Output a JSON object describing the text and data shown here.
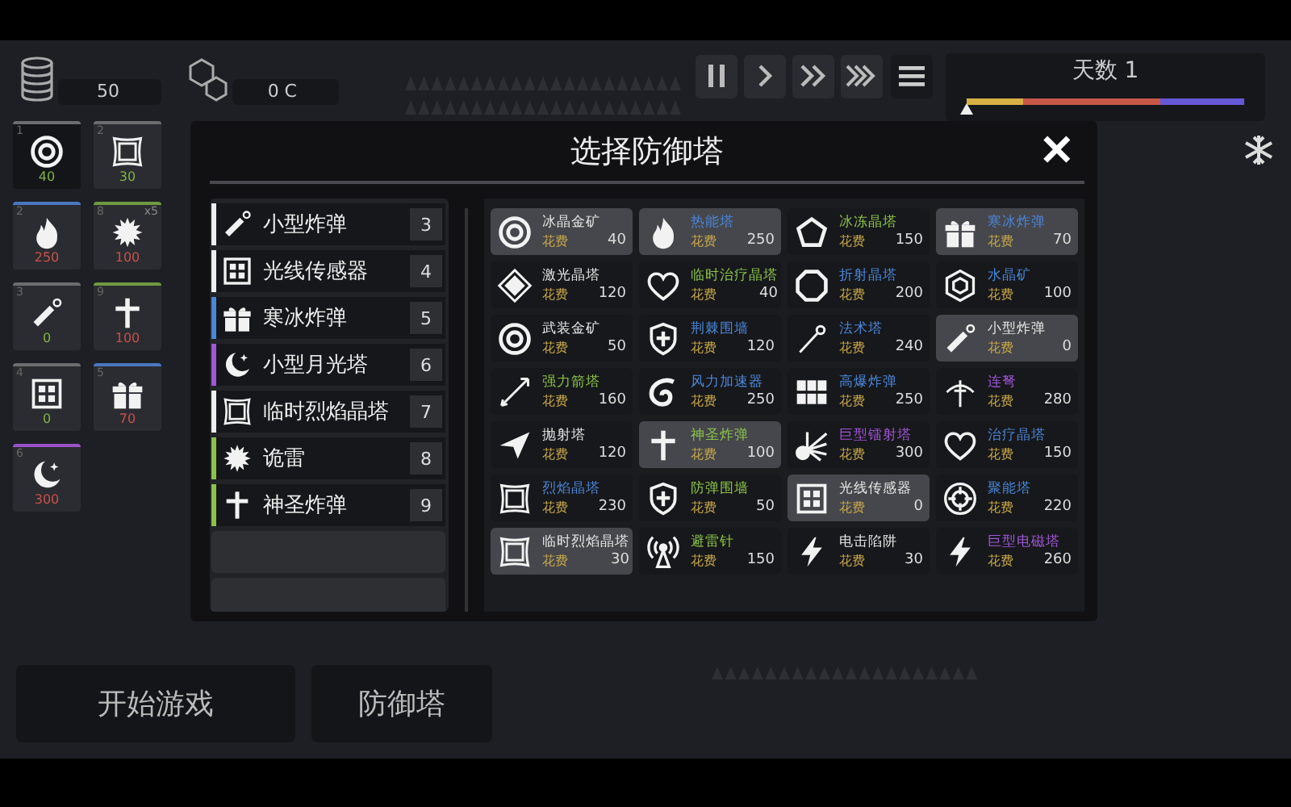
{
  "resources": {
    "coins": "50",
    "crystals": "0 C"
  },
  "day": {
    "label": "天数 1",
    "level": 0,
    "segments": [
      {
        "color": "#d6b044"
      },
      {
        "color": "#c8574a"
      },
      {
        "color": "#6658d6"
      }
    ]
  },
  "loadout": [
    {
      "slot": "1",
      "kind": "ring",
      "cost": "40",
      "affordable": true,
      "color": "#6d6d70",
      "selected": true
    },
    {
      "slot": "2",
      "kind": "frame",
      "cost": "30",
      "affordable": true,
      "color": "#6d6d70",
      "selected": false
    },
    {
      "slot": "2",
      "kind": "flame",
      "cost": "250",
      "affordable": false,
      "color": "#4a78c0",
      "selected": false
    },
    {
      "slot": "8",
      "kind": "burst",
      "cost": "100",
      "affordable": false,
      "color": "#6f9a3e",
      "selected": false,
      "badge": "x5"
    },
    {
      "slot": "3",
      "kind": "stick",
      "cost": "0",
      "affordable": true,
      "color": "#6d6d70",
      "selected": false
    },
    {
      "slot": "9",
      "kind": "cross",
      "cost": "100",
      "affordable": false,
      "color": "#6f9a3e",
      "selected": false
    },
    {
      "slot": "4",
      "kind": "grid",
      "cost": "0",
      "affordable": true,
      "color": "#6d6d70",
      "selected": false
    },
    {
      "slot": "5",
      "kind": "gift",
      "cost": "70",
      "affordable": false,
      "color": "#4a78c0",
      "selected": false
    },
    {
      "slot": "6",
      "kind": "moon",
      "cost": "300",
      "affordable": false,
      "color": "#9a52c8",
      "selected": false
    }
  ],
  "dialog": {
    "title": "选择防御塔",
    "close": "✕",
    "picked": [
      {
        "name": "小型炸弹",
        "key": "3",
        "kind": "stick",
        "color": "#eeeeee"
      },
      {
        "name": "光线传感器",
        "key": "4",
        "kind": "grid",
        "color": "#eeeeee"
      },
      {
        "name": "寒冰炸弹",
        "key": "5",
        "kind": "gift",
        "color": "#4a86d8"
      },
      {
        "name": "小型月光塔",
        "key": "6",
        "kind": "moon",
        "color": "#a057d8"
      },
      {
        "name": "临时烈焰晶塔",
        "key": "7",
        "kind": "frame",
        "color": "#eeeeee"
      },
      {
        "name": "诡雷",
        "key": "8",
        "kind": "burst",
        "color": "#8bc34a"
      },
      {
        "name": "神圣炸弹",
        "key": "9",
        "kind": "cross",
        "color": "#8bc34a"
      }
    ],
    "empty_slots": [
      {
        "kind": "empty"
      },
      {
        "kind": "empty"
      }
    ],
    "towers": [
      {
        "name": "冰晶金矿",
        "cost_label": "花费",
        "cost": "40",
        "kind": "ring",
        "color": "#e6e6e6",
        "selected": true
      },
      {
        "name": "热能塔",
        "cost_label": "花费",
        "cost": "250",
        "kind": "flame",
        "color": "#4a86d8",
        "selected": true
      },
      {
        "name": "冰冻晶塔",
        "cost_label": "花费",
        "cost": "150",
        "kind": "pentagon",
        "color": "#8bc34a",
        "selected": false
      },
      {
        "name": "寒冰炸弹",
        "cost_label": "花费",
        "cost": "70",
        "kind": "gift",
        "color": "#4a86d8",
        "selected": true
      },
      {
        "name": "激光晶塔",
        "cost_label": "花费",
        "cost": "120",
        "kind": "diamond",
        "color": "#e6e6e6",
        "selected": false
      },
      {
        "name": "临时治疗晶塔",
        "cost_label": "花费",
        "cost": "40",
        "kind": "heart",
        "color": "#8bc34a",
        "selected": false
      },
      {
        "name": "折射晶塔",
        "cost_label": "花费",
        "cost": "200",
        "kind": "octagon",
        "color": "#4a86d8",
        "selected": false
      },
      {
        "name": "水晶矿",
        "cost_label": "花费",
        "cost": "100",
        "kind": "gem",
        "color": "#4a86d8",
        "selected": false
      },
      {
        "name": "武装金矿",
        "cost_label": "花费",
        "cost": "50",
        "kind": "ring",
        "color": "#e6e6e6",
        "selected": false
      },
      {
        "name": "荆棘围墙",
        "cost_label": "花费",
        "cost": "120",
        "kind": "shield",
        "color": "#4a86d8",
        "selected": false
      },
      {
        "name": "法术塔",
        "cost_label": "花费",
        "cost": "240",
        "kind": "wand",
        "color": "#4a86d8",
        "selected": false
      },
      {
        "name": "小型炸弹",
        "cost_label": "花费",
        "cost": "0",
        "kind": "stick",
        "color": "#e6e6e6",
        "selected": true
      },
      {
        "name": "强力箭塔",
        "cost_label": "花费",
        "cost": "160",
        "kind": "arrow",
        "color": "#8bc34a",
        "selected": false
      },
      {
        "name": "风力加速器",
        "cost_label": "花费",
        "cost": "250",
        "kind": "swirl",
        "color": "#4a86d8",
        "selected": false
      },
      {
        "name": "高爆炸弹",
        "cost_label": "花费",
        "cost": "250",
        "kind": "cube",
        "color": "#4a86d8",
        "selected": false
      },
      {
        "name": "连弩",
        "cost_label": "花费",
        "cost": "280",
        "kind": "crossbow",
        "color": "#a057d8",
        "selected": false
      },
      {
        "name": "抛射塔",
        "cost_label": "花费",
        "cost": "120",
        "kind": "plane",
        "color": "#e6e6e6",
        "selected": false
      },
      {
        "name": "神圣炸弹",
        "cost_label": "花费",
        "cost": "100",
        "kind": "cross",
        "color": "#8bc34a",
        "selected": true
      },
      {
        "name": "巨型镭射塔",
        "cost_label": "花费",
        "cost": "300",
        "kind": "rays",
        "color": "#a057d8",
        "selected": false
      },
      {
        "name": "治疗晶塔",
        "cost_label": "花费",
        "cost": "150",
        "kind": "heart",
        "color": "#4a86d8",
        "selected": false
      },
      {
        "name": "烈焰晶塔",
        "cost_label": "花费",
        "cost": "230",
        "kind": "frame",
        "color": "#4a86d8",
        "selected": false
      },
      {
        "name": "防弹围墙",
        "cost_label": "花费",
        "cost": "50",
        "kind": "shield",
        "color": "#8bc34a",
        "selected": false
      },
      {
        "name": "光线传感器",
        "cost_label": "花费",
        "cost": "0",
        "kind": "grid",
        "color": "#e6e6e6",
        "selected": true
      },
      {
        "name": "聚能塔",
        "cost_label": "花费",
        "cost": "220",
        "kind": "target",
        "color": "#4a86d8",
        "selected": false
      },
      {
        "name": "临时烈焰晶塔",
        "cost_label": "花费",
        "cost": "30",
        "kind": "frame",
        "color": "#e6e6e6",
        "selected": true
      },
      {
        "name": "避雷针",
        "cost_label": "花费",
        "cost": "150",
        "kind": "antenna",
        "color": "#8bc34a",
        "selected": false
      },
      {
        "name": "电击陷阱",
        "cost_label": "花费",
        "cost": "30",
        "kind": "bolt",
        "color": "#e6e6e6",
        "selected": false
      },
      {
        "name": "巨型电磁塔",
        "cost_label": "花费",
        "cost": "260",
        "kind": "bolt",
        "color": "#a057d8",
        "selected": false
      }
    ]
  },
  "buttons": [
    {
      "label": "开始游戏"
    },
    {
      "label": "防御塔"
    }
  ]
}
